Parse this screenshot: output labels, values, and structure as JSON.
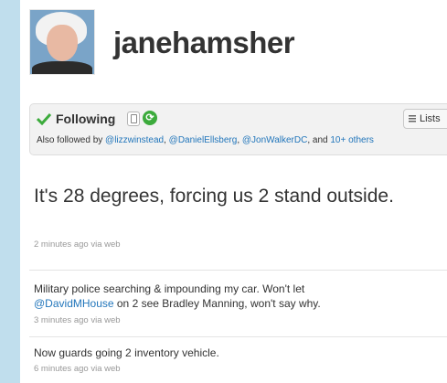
{
  "profile": {
    "screen_name": "janehamsher"
  },
  "follow": {
    "status_label": "Following",
    "lists_label": "Lists",
    "also_followed_prefix": "Also followed by",
    "followers": [
      "@lizzwinstead",
      "@DanielEllsberg",
      "@JonWalkerDC"
    ],
    "and_text": "and",
    "others_link": "10+ others"
  },
  "tweets": [
    {
      "text": "It's 28 degrees, forcing us 2 stand outside.",
      "time": "2 minutes ago",
      "via": "via web"
    },
    {
      "text_line1": "Military police searching & impounding my car. Won't let",
      "mention": "@DavidMHouse",
      "text_line2_rest": " on 2 see Bradley Manning, won't say why.",
      "time": "3 minutes ago",
      "via": "via web"
    },
    {
      "text": "Now guards going 2 inventory vehicle.",
      "time": "6 minutes ago",
      "via": "via web"
    }
  ],
  "colors": {
    "background": "#c0deed",
    "link": "#2276bb",
    "check": "#3cab3c"
  }
}
